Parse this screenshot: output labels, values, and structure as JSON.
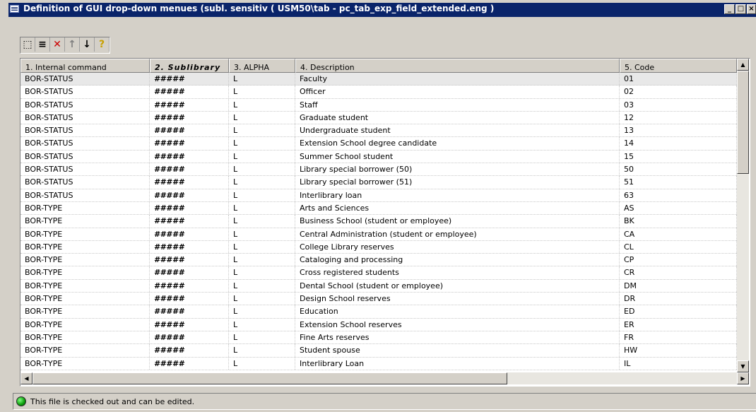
{
  "window": {
    "title": "Definition of GUI drop-down menues (subl. sensitiv  ( USM50\\tab -  pc_tab_exp_field_extended.eng )",
    "controls": [
      "_",
      "□",
      "×"
    ]
  },
  "toolbar": {
    "buttons": [
      {
        "name": "new-row-icon",
        "glyph": "⬚"
      },
      {
        "name": "list-icon",
        "glyph": "≡"
      },
      {
        "name": "delete-icon",
        "glyph": "✕",
        "color": "#cc0000"
      },
      {
        "name": "move-up-icon",
        "glyph": "↑",
        "color": "#808080"
      },
      {
        "name": "move-down-icon",
        "glyph": "↓"
      },
      {
        "name": "help-icon",
        "glyph": "?",
        "color": "#c8a000"
      }
    ]
  },
  "table": {
    "columns": [
      "1. Internal command",
      "2. Sublibrary",
      "3. ALPHA",
      "4. Description",
      "5. Code"
    ],
    "rows": [
      [
        "BOR-STATUS",
        "#####",
        "L",
        "Faculty",
        "01"
      ],
      [
        "BOR-STATUS",
        "#####",
        "L",
        "Officer",
        "02"
      ],
      [
        "BOR-STATUS",
        "#####",
        "L",
        "Staff",
        "03"
      ],
      [
        "BOR-STATUS",
        "#####",
        "L",
        "Graduate student",
        "12"
      ],
      [
        "BOR-STATUS",
        "#####",
        "L",
        "Undergraduate student",
        "13"
      ],
      [
        "BOR-STATUS",
        "#####",
        "L",
        "Extension School degree candidate",
        "14"
      ],
      [
        "BOR-STATUS",
        "#####",
        "L",
        "Summer School student",
        "15"
      ],
      [
        "BOR-STATUS",
        "#####",
        "L",
        "Library special borrower (50)",
        "50"
      ],
      [
        "BOR-STATUS",
        "#####",
        "L",
        "Library special borrower (51)",
        "51"
      ],
      [
        "BOR-STATUS",
        "#####",
        "L",
        "Interlibrary loan",
        "63"
      ],
      [
        "BOR-TYPE",
        "#####",
        "L",
        "Arts and Sciences",
        "AS"
      ],
      [
        "BOR-TYPE",
        "#####",
        "L",
        "Business School (student or employee)",
        "BK"
      ],
      [
        "BOR-TYPE",
        "#####",
        "L",
        "Central Administration (student or employee)",
        "CA"
      ],
      [
        "BOR-TYPE",
        "#####",
        "L",
        "College Library reserves",
        "CL"
      ],
      [
        "BOR-TYPE",
        "#####",
        "L",
        "Cataloging and processing",
        "CP"
      ],
      [
        "BOR-TYPE",
        "#####",
        "L",
        "Cross registered students",
        "CR"
      ],
      [
        "BOR-TYPE",
        "#####",
        "L",
        "Dental School (student or employee)",
        "DM"
      ],
      [
        "BOR-TYPE",
        "#####",
        "L",
        "Design School reserves",
        "DR"
      ],
      [
        "BOR-TYPE",
        "#####",
        "L",
        "Education",
        "ED"
      ],
      [
        "BOR-TYPE",
        "#####",
        "L",
        "Extension School reserves",
        "ER"
      ],
      [
        "BOR-TYPE",
        "#####",
        "L",
        "Fine Arts reserves",
        "FR"
      ],
      [
        "BOR-TYPE",
        "#####",
        "L",
        "Student spouse",
        "HW"
      ],
      [
        "BOR-TYPE",
        "#####",
        "L",
        "Interlibrary Loan",
        "IL"
      ]
    ],
    "selected_row": 0
  },
  "status": {
    "text": "This file is checked out and can be edited.",
    "led_color": "#0a9a0a"
  }
}
